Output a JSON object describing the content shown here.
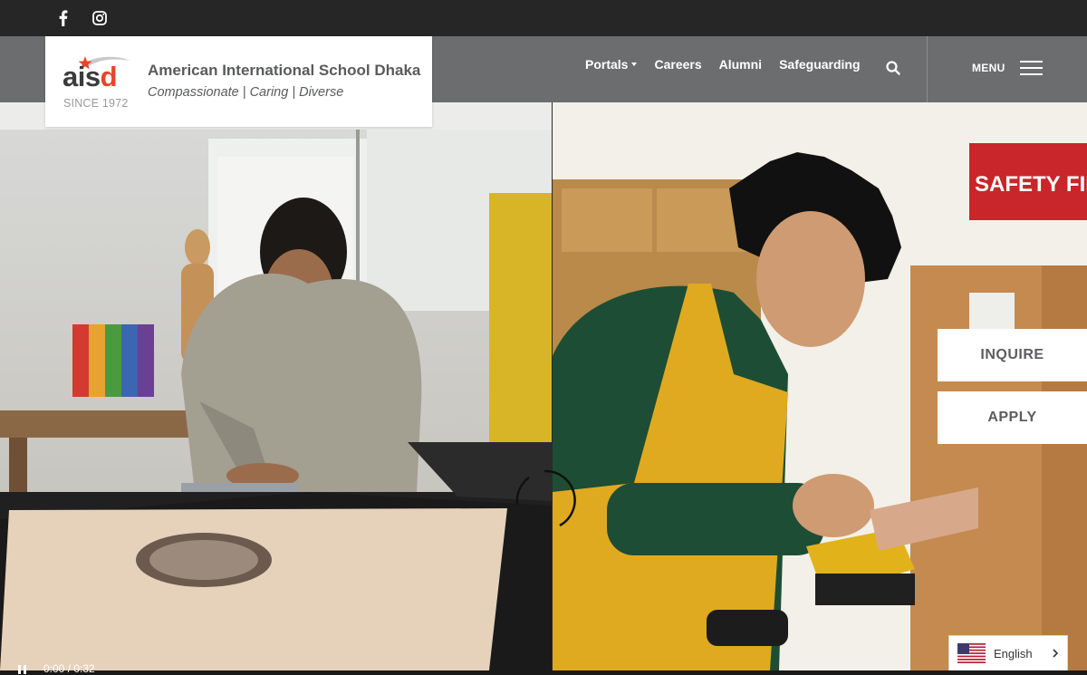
{
  "social": {
    "facebook_icon": "facebook-icon",
    "instagram_icon": "instagram-icon"
  },
  "logo": {
    "wordmark_main": "ais",
    "wordmark_accent": "d",
    "since": "SINCE 1972",
    "school_name": "American International School Dhaka",
    "tagline": "Compassionate | Caring | Diverse"
  },
  "nav": {
    "links": [
      {
        "label": "Portals",
        "has_dropdown": true
      },
      {
        "label": "Careers"
      },
      {
        "label": "Alumni"
      },
      {
        "label": "Safeguarding"
      }
    ],
    "search_icon": "search-icon",
    "menu_label": "MENU"
  },
  "hero": {
    "left_image": "teacher cutting mat board over a portrait artwork in an art studio",
    "right_image": "student in yellow apron sanding wood in a workshop",
    "sign_text": "SAFETY FIRS"
  },
  "cta": {
    "inquire": "INQUIRE",
    "apply": "APPLY"
  },
  "language": {
    "selected": "English",
    "flag": "us-flag-icon"
  },
  "video": {
    "time": "0:00 / 0:32",
    "state": "playing"
  },
  "colors": {
    "topbar": "#262626",
    "navbar": "#6c6d6f",
    "brand_red": "#e8442c",
    "text_gray": "#5a5b5d"
  }
}
